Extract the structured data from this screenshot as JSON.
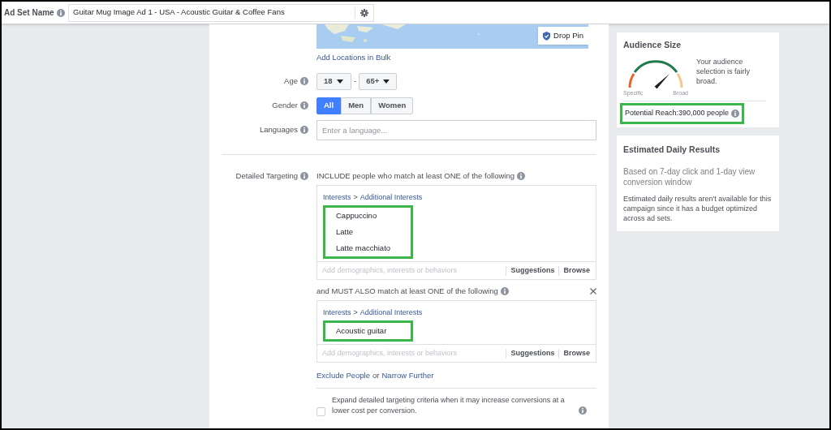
{
  "ad_set_name": {
    "label": "Ad Set Name",
    "value": "Guitar Mug Image Ad 1 - USA - Acoustic Guitar & Coffee Fans"
  },
  "location": {
    "drop_pin": "Drop Pin",
    "bulk_link": "Add Locations in Bulk"
  },
  "age": {
    "label": "Age",
    "from": "18",
    "separator": "-",
    "to": "65+"
  },
  "gender": {
    "label": "Gender",
    "options": [
      {
        "label": "All",
        "selected": true
      },
      {
        "label": "Men",
        "selected": false
      },
      {
        "label": "Women",
        "selected": false
      }
    ]
  },
  "languages": {
    "label": "Languages",
    "placeholder": "Enter a language..."
  },
  "detailed_targeting": {
    "label": "Detailed Targeting",
    "groups": [
      {
        "heading": "INCLUDE people who match at least ONE of the following",
        "removable": false,
        "path": [
          "Interests",
          "Additional Interests"
        ],
        "path_separator": ">",
        "highlighted": true,
        "interests": [
          "Cappuccino",
          "Latte",
          "Latte macchiato"
        ],
        "placeholder": "Add demographics, interests or behaviors",
        "actions": [
          "Suggestions",
          "Browse"
        ]
      },
      {
        "heading": "and MUST ALSO match at least ONE of the following",
        "removable": true,
        "path": [
          "Interests",
          "Additional Interests"
        ],
        "path_separator": ">",
        "highlighted": true,
        "interests": [
          "Acoustic guitar"
        ],
        "placeholder": "Add demographics, interests or behaviors",
        "actions": [
          "Suggestions",
          "Browse"
        ]
      }
    ],
    "exclude_link": "Exclude People",
    "conjunction": "or",
    "narrow_link": "Narrow Further",
    "expand": {
      "checked": false,
      "text": "Expand detailed targeting criteria when it may increase conversions at a lower cost per conversion."
    }
  },
  "audience_size": {
    "title": "Audience Size",
    "low_label": "Specific",
    "high_label": "Broad",
    "description": "Your audience selection is fairly broad.",
    "potential_reach": "Potential Reach:390,000 people",
    "highlighted": true
  },
  "estimated_daily_results": {
    "title": "Estimated Daily Results",
    "subtitle": "Based on 7-day click and 1-day view conversion window",
    "note": "Estimated daily results aren't available for this campaign since it has a budget optimized across ad sets."
  }
}
